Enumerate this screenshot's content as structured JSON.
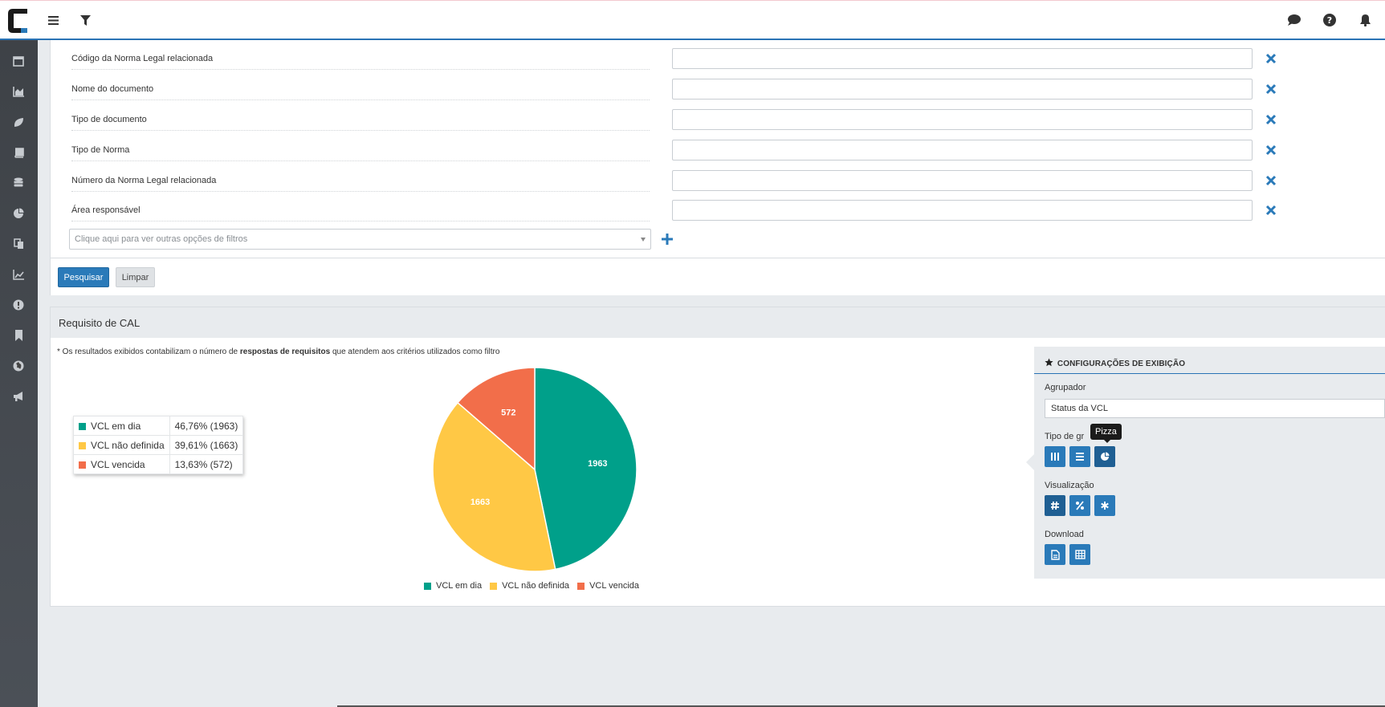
{
  "filters": {
    "rows": [
      {
        "label": "Código da Norma Legal relacionada",
        "value": ""
      },
      {
        "label": "Nome do documento",
        "value": ""
      },
      {
        "label": "Tipo de documento",
        "value": ""
      },
      {
        "label": "Tipo de Norma",
        "value": ""
      },
      {
        "label": "Número da Norma Legal relacionada",
        "value": ""
      },
      {
        "label": "Área responsável",
        "value": ""
      }
    ],
    "more_placeholder": "Clique aqui para ver outras opções de filtros",
    "search_label": "Pesquisar",
    "clear_label": "Limpar"
  },
  "result": {
    "title": "Requisito de CAL",
    "note_prefix": "* Os resultados exibidos contabilizam o número de ",
    "note_bold": "respostas de requisitos",
    "note_suffix": " que atendem aos critérios utilizados como filtro",
    "legend_rows": [
      {
        "name": "VCL em dia",
        "value": "46,76% (1963)"
      },
      {
        "name": "VCL não definida",
        "value": "39,61% (1663)"
      },
      {
        "name": "VCL vencida",
        "value": "13,63% (572)"
      }
    ]
  },
  "config": {
    "header": "CONFIGURAÇÕES DE EXIBIÇÃO",
    "grouper_label": "Agrupador",
    "grouper_value": "Status da VCL",
    "chart_type_label": "Tipo de gráfico",
    "chart_type_label_visible": "Tipo de gr",
    "tooltip": "Pizza",
    "view_label": "Visualização",
    "download_label": "Download"
  },
  "colors": {
    "accent": "#2a7ab9",
    "series": [
      "#00a08a",
      "#ffc845",
      "#f26e4a"
    ]
  },
  "chart_data": {
    "type": "pie",
    "categories": [
      "VCL em dia",
      "VCL não definida",
      "VCL vencida"
    ],
    "values": [
      1963,
      1663,
      572
    ],
    "legend": "bottom"
  }
}
